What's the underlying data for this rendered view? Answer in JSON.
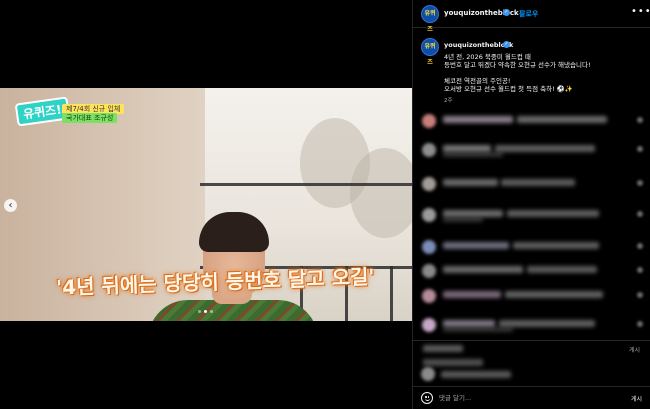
{
  "media": {
    "logo": "유퀴즈!",
    "episode_tag": "제7/4회 신규 입체",
    "guest_tag": "국가대표 조규성",
    "subtitle": "'4년 뒤에는 당당히 등번호 달고 오길'",
    "carousel": {
      "count": 3,
      "active": 2
    }
  },
  "header": {
    "username": "youquizontheblock",
    "separator": "•",
    "follow_label": "팔로우",
    "more_label": "•••",
    "avatar_text": "유퀴즈"
  },
  "post": {
    "username": "youquizontheblock",
    "caption_lines": [
      "4년 전, 2026 북중미 월드컵 때",
      "등번호 달고 뛰겠다 약속한 오현규 선수가 해냈습니다!",
      "",
      "체코전 역전골의 주인공!",
      "오서방 오현규 선수 월드컵 첫 득점 축하! ⚽✨"
    ],
    "time": "2주"
  },
  "actions": {
    "post_label": "게시"
  },
  "comment_box": {
    "placeholder": "댓글 달기...",
    "submit_label": "게시"
  },
  "colors": {
    "background": "#000000",
    "link": "#0095f6",
    "verified": "#3897f0",
    "subtitle_glow": "#e77a22"
  }
}
